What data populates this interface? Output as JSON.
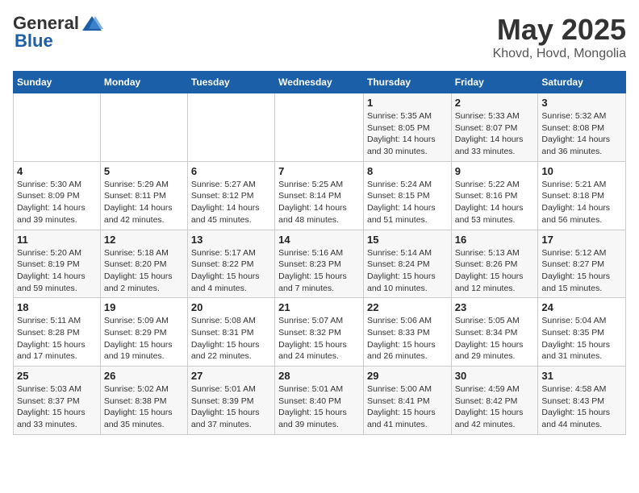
{
  "app": {
    "name": "GeneralBlue",
    "logo_general": "General",
    "logo_blue": "Blue"
  },
  "title": "May 2025",
  "subtitle": "Khovd, Hovd, Mongolia",
  "days_of_week": [
    "Sunday",
    "Monday",
    "Tuesday",
    "Wednesday",
    "Thursday",
    "Friday",
    "Saturday"
  ],
  "weeks": [
    [
      {
        "day": "",
        "info": ""
      },
      {
        "day": "",
        "info": ""
      },
      {
        "day": "",
        "info": ""
      },
      {
        "day": "",
        "info": ""
      },
      {
        "day": "1",
        "info": "Sunrise: 5:35 AM\nSunset: 8:05 PM\nDaylight: 14 hours\nand 30 minutes."
      },
      {
        "day": "2",
        "info": "Sunrise: 5:33 AM\nSunset: 8:07 PM\nDaylight: 14 hours\nand 33 minutes."
      },
      {
        "day": "3",
        "info": "Sunrise: 5:32 AM\nSunset: 8:08 PM\nDaylight: 14 hours\nand 36 minutes."
      }
    ],
    [
      {
        "day": "4",
        "info": "Sunrise: 5:30 AM\nSunset: 8:09 PM\nDaylight: 14 hours\nand 39 minutes."
      },
      {
        "day": "5",
        "info": "Sunrise: 5:29 AM\nSunset: 8:11 PM\nDaylight: 14 hours\nand 42 minutes."
      },
      {
        "day": "6",
        "info": "Sunrise: 5:27 AM\nSunset: 8:12 PM\nDaylight: 14 hours\nand 45 minutes."
      },
      {
        "day": "7",
        "info": "Sunrise: 5:25 AM\nSunset: 8:14 PM\nDaylight: 14 hours\nand 48 minutes."
      },
      {
        "day": "8",
        "info": "Sunrise: 5:24 AM\nSunset: 8:15 PM\nDaylight: 14 hours\nand 51 minutes."
      },
      {
        "day": "9",
        "info": "Sunrise: 5:22 AM\nSunset: 8:16 PM\nDaylight: 14 hours\nand 53 minutes."
      },
      {
        "day": "10",
        "info": "Sunrise: 5:21 AM\nSunset: 8:18 PM\nDaylight: 14 hours\nand 56 minutes."
      }
    ],
    [
      {
        "day": "11",
        "info": "Sunrise: 5:20 AM\nSunset: 8:19 PM\nDaylight: 14 hours\nand 59 minutes."
      },
      {
        "day": "12",
        "info": "Sunrise: 5:18 AM\nSunset: 8:20 PM\nDaylight: 15 hours\nand 2 minutes."
      },
      {
        "day": "13",
        "info": "Sunrise: 5:17 AM\nSunset: 8:22 PM\nDaylight: 15 hours\nand 4 minutes."
      },
      {
        "day": "14",
        "info": "Sunrise: 5:16 AM\nSunset: 8:23 PM\nDaylight: 15 hours\nand 7 minutes."
      },
      {
        "day": "15",
        "info": "Sunrise: 5:14 AM\nSunset: 8:24 PM\nDaylight: 15 hours\nand 10 minutes."
      },
      {
        "day": "16",
        "info": "Sunrise: 5:13 AM\nSunset: 8:26 PM\nDaylight: 15 hours\nand 12 minutes."
      },
      {
        "day": "17",
        "info": "Sunrise: 5:12 AM\nSunset: 8:27 PM\nDaylight: 15 hours\nand 15 minutes."
      }
    ],
    [
      {
        "day": "18",
        "info": "Sunrise: 5:11 AM\nSunset: 8:28 PM\nDaylight: 15 hours\nand 17 minutes."
      },
      {
        "day": "19",
        "info": "Sunrise: 5:09 AM\nSunset: 8:29 PM\nDaylight: 15 hours\nand 19 minutes."
      },
      {
        "day": "20",
        "info": "Sunrise: 5:08 AM\nSunset: 8:31 PM\nDaylight: 15 hours\nand 22 minutes."
      },
      {
        "day": "21",
        "info": "Sunrise: 5:07 AM\nSunset: 8:32 PM\nDaylight: 15 hours\nand 24 minutes."
      },
      {
        "day": "22",
        "info": "Sunrise: 5:06 AM\nSunset: 8:33 PM\nDaylight: 15 hours\nand 26 minutes."
      },
      {
        "day": "23",
        "info": "Sunrise: 5:05 AM\nSunset: 8:34 PM\nDaylight: 15 hours\nand 29 minutes."
      },
      {
        "day": "24",
        "info": "Sunrise: 5:04 AM\nSunset: 8:35 PM\nDaylight: 15 hours\nand 31 minutes."
      }
    ],
    [
      {
        "day": "25",
        "info": "Sunrise: 5:03 AM\nSunset: 8:37 PM\nDaylight: 15 hours\nand 33 minutes."
      },
      {
        "day": "26",
        "info": "Sunrise: 5:02 AM\nSunset: 8:38 PM\nDaylight: 15 hours\nand 35 minutes."
      },
      {
        "day": "27",
        "info": "Sunrise: 5:01 AM\nSunset: 8:39 PM\nDaylight: 15 hours\nand 37 minutes."
      },
      {
        "day": "28",
        "info": "Sunrise: 5:01 AM\nSunset: 8:40 PM\nDaylight: 15 hours\nand 39 minutes."
      },
      {
        "day": "29",
        "info": "Sunrise: 5:00 AM\nSunset: 8:41 PM\nDaylight: 15 hours\nand 41 minutes."
      },
      {
        "day": "30",
        "info": "Sunrise: 4:59 AM\nSunset: 8:42 PM\nDaylight: 15 hours\nand 42 minutes."
      },
      {
        "day": "31",
        "info": "Sunrise: 4:58 AM\nSunset: 8:43 PM\nDaylight: 15 hours\nand 44 minutes."
      }
    ]
  ]
}
